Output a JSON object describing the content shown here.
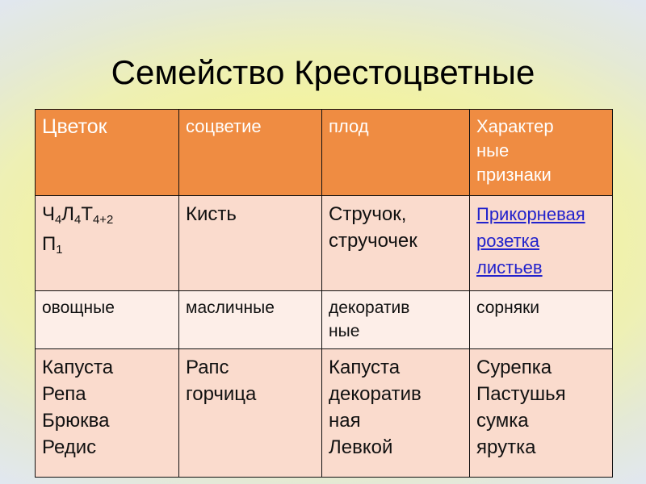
{
  "slide": {
    "title": "Семейство Крестоцветные",
    "background_top_color": "#e1e7ef",
    "background_mid_color": "#f4f39a"
  },
  "table": {
    "header_bg": "#ef8c42",
    "header_text_color": "#ffffff",
    "row_bg_dark": "#fadbcd",
    "row_bg_light": "#fdeee8",
    "border_color": "#111111",
    "headers": [
      "Цветок",
      "соцветие",
      "плод",
      "Характер\nные\nпризнаки"
    ],
    "rows": [
      {
        "name": "formula-row",
        "cells": [
          {
            "type": "formula",
            "parts": [
              {
                "base": "Ч",
                "sub": "4"
              },
              {
                "base": "Л",
                "sub": "4"
              },
              {
                "base": "Т",
                "sub": "4+2"
              },
              {
                "base": "\nП",
                "sub": "1"
              }
            ],
            "plain": "Ч4Л4Т4+2 П1"
          },
          {
            "type": "text",
            "value": "Кисть"
          },
          {
            "type": "text",
            "value": "Стручок,\nстручочек"
          },
          {
            "type": "link",
            "value": "Прикорневая розетка листьев",
            "color": "#2222cc"
          }
        ]
      },
      {
        "name": "usage-row",
        "cells": [
          {
            "type": "text",
            "value": "овощные"
          },
          {
            "type": "text",
            "value": "масличные"
          },
          {
            "type": "text",
            "value": "декоратив\nные"
          },
          {
            "type": "text",
            "value": "сорняки"
          }
        ]
      },
      {
        "name": "examples-row",
        "cells": [
          {
            "type": "text",
            "value": "Капуста\nРепа\nБрюква\nРедис"
          },
          {
            "type": "text",
            "value": "Рапс\nгорчица"
          },
          {
            "type": "text",
            "value": "Капуста\nдекоратив\nная\nЛевкой"
          },
          {
            "type": "text",
            "value": "Сурепка\nПастушья\nсумка\nярутка"
          }
        ]
      }
    ]
  }
}
